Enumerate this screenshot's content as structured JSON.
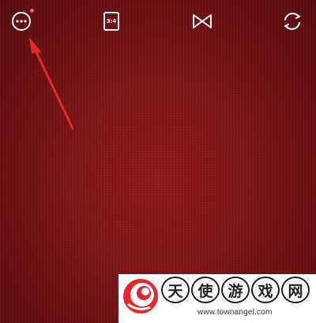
{
  "toolbar": {
    "more_icon": "more-horizontal-circle-icon",
    "has_notification_dot": true,
    "ratio_label": "3:4",
    "filter_icon": "bowtie-filter-icon",
    "flip_icon": "camera-flip-icon"
  },
  "viewfinder": {
    "background_color": "#7a1414"
  },
  "annotation": {
    "arrow_color": "#e8262c"
  },
  "watermark": {
    "chars": [
      "天",
      "使",
      "游",
      "戏",
      "网"
    ],
    "url": "www.townangel.com"
  }
}
